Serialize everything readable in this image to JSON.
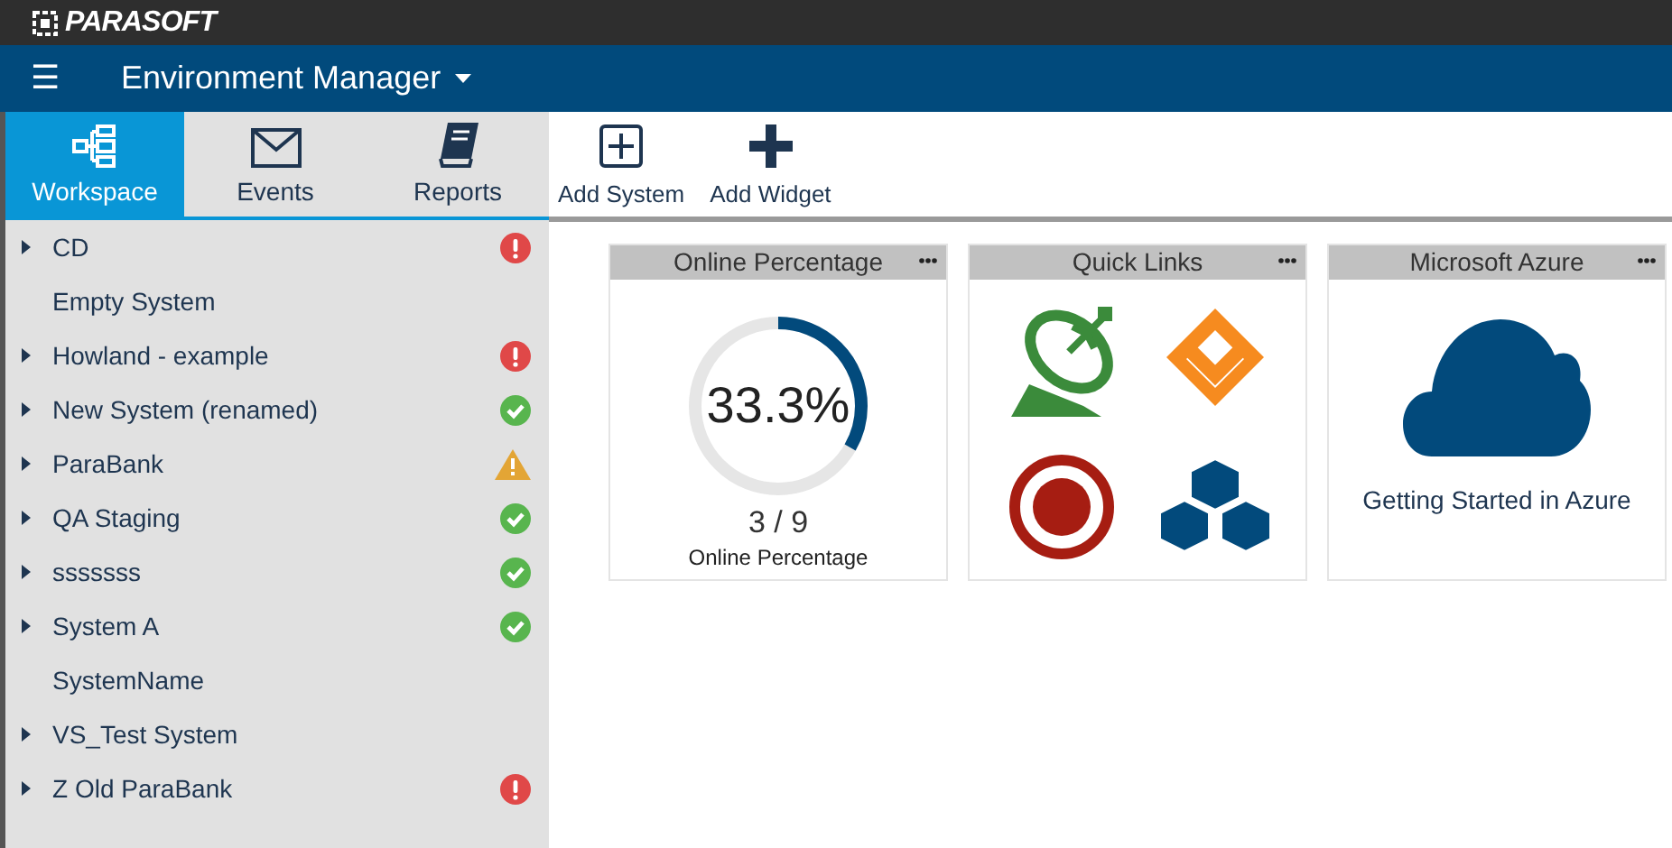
{
  "brand": {
    "logo": "PARASOFT"
  },
  "header": {
    "menu_icon": "☰",
    "title": "Environment Manager"
  },
  "tabs": [
    {
      "label": "Workspace",
      "selected": true
    },
    {
      "label": "Events",
      "selected": false
    },
    {
      "label": "Reports",
      "selected": false
    }
  ],
  "toolbar": [
    {
      "label": "Add System",
      "kind": "system"
    },
    {
      "label": "Add Widget",
      "kind": "widget"
    }
  ],
  "systems": [
    {
      "name": "CD",
      "expandable": true,
      "kind": "error"
    },
    {
      "name": "Empty System",
      "expandable": false,
      "kind": "plain"
    },
    {
      "name": "Howland - example",
      "expandable": true,
      "kind": "error"
    },
    {
      "name": "New System (renamed)",
      "expandable": true,
      "kind": "ok"
    },
    {
      "name": "ParaBank",
      "expandable": true,
      "kind": "warning"
    },
    {
      "name": "QA Staging",
      "expandable": true,
      "kind": "ok"
    },
    {
      "name": "sssssss",
      "expandable": true,
      "kind": "ok"
    },
    {
      "name": "System A",
      "expandable": true,
      "kind": "ok"
    },
    {
      "name": "SystemName",
      "expandable": false,
      "kind": "plain"
    },
    {
      "name": "VS_Test System",
      "expandable": true,
      "kind": "plain"
    },
    {
      "name": "Z Old ParaBank",
      "expandable": true,
      "kind": "error"
    }
  ],
  "widgets": [
    {
      "title": "Online Percentage",
      "kind": "gauge",
      "value": "33.3%",
      "level": 0.333,
      "count": "3 / 9",
      "caption": "Online Percentage"
    },
    {
      "title": "Quick Links",
      "kind": "links"
    },
    {
      "title": "Microsoft Azure",
      "kind": "azure",
      "link": "Getting Started in Azure"
    }
  ]
}
